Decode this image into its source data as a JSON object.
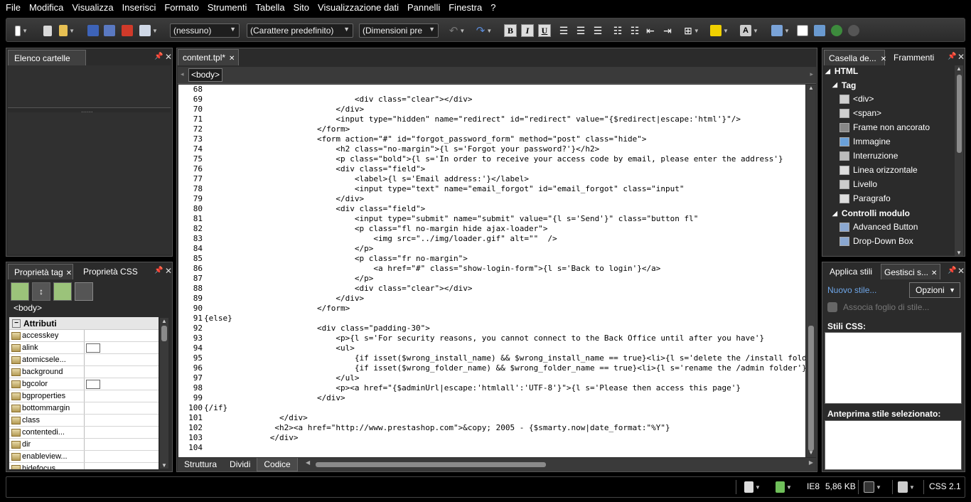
{
  "menu": [
    "File",
    "Modifica",
    "Visualizza",
    "Inserisci",
    "Formato",
    "Strumenti",
    "Tabella",
    "Sito",
    "Visualizzazione dati",
    "Pannelli",
    "Finestra",
    "?"
  ],
  "toolbar": {
    "style_select": "(nessuno)",
    "font_select": "(Carattere predefinito)",
    "size_select": "(Dimensioni pre",
    "bold": "B",
    "italic": "I",
    "underline": "U"
  },
  "folders_panel": {
    "title": "Elenco cartelle"
  },
  "tag_panel": {
    "tab1": "Proprietà tag",
    "tab2": "Proprietà CSS",
    "current_tag": "<body>",
    "section": "Attributi",
    "rows": [
      {
        "name": "accesskey",
        "has_color": false
      },
      {
        "name": "alink",
        "has_color": true
      },
      {
        "name": "atomicsele...",
        "has_color": false
      },
      {
        "name": "background",
        "has_color": false
      },
      {
        "name": "bgcolor",
        "has_color": true
      },
      {
        "name": "bgproperties",
        "has_color": false
      },
      {
        "name": "bottommargin",
        "has_color": false
      },
      {
        "name": "class",
        "has_color": false
      },
      {
        "name": "contentedi...",
        "has_color": false
      },
      {
        "name": "dir",
        "has_color": false
      },
      {
        "name": "enableview...",
        "has_color": false
      },
      {
        "name": "hidefocus",
        "has_color": false
      }
    ]
  },
  "editor": {
    "tab": "content.tpl*",
    "breadcrumb": "<body>",
    "lines": [
      {
        "n": "68",
        "t": ""
      },
      {
        "n": "69",
        "t": "                                &lt;div class=&quot;clear&quot;&gt;&lt;/div&gt;"
      },
      {
        "n": "70",
        "t": "                            &lt;/div&gt;"
      },
      {
        "n": "71",
        "t": "                            &lt;input type=&quot;hidden&quot; name=&quot;redirect&quot; id=&quot;redirect&quot; value=&quot;{$redirect|escape:'html'}&quot;/&gt;"
      },
      {
        "n": "72",
        "t": "                        &lt;/form&gt;"
      },
      {
        "n": "73",
        "t": "                        &lt;form action=&quot;#&quot; id=&quot;forgot_password_form&quot; method=&quot;post&quot; class=&quot;hide&quot;&gt;"
      },
      {
        "n": "74",
        "t": "                            &lt;h2 class=&quot;no-margin&quot;&gt;{l s='Forgot your password?'}&lt;/h2&gt;"
      },
      {
        "n": "75",
        "t": "                            &lt;p class=&quot;bold&quot;&gt;{l s='In order to receive your access code by email, please enter the address'}"
      },
      {
        "n": "76",
        "t": "                            &lt;div class=&quot;field&quot;&gt;"
      },
      {
        "n": "77",
        "t": "                                &lt;label&gt;{l s='Email address:'}&lt;/label&gt;"
      },
      {
        "n": "78",
        "t": "                                &lt;input type=&quot;text&quot; name=&quot;email_forgot&quot; id=&quot;email_forgot&quot; class=&quot;input&quot;"
      },
      {
        "n": "79",
        "t": "                            &lt;/div&gt;"
      },
      {
        "n": "80",
        "t": "                            &lt;div class=&quot;field&quot;&gt;"
      },
      {
        "n": "81",
        "t": "                                &lt;input type=&quot;submit&quot; name=&quot;submit&quot; value=&quot;{l s='Send'}&quot; class=&quot;button fl&quot;"
      },
      {
        "n": "82",
        "t": "                                &lt;p class=&quot;fl no-margin hide ajax-loader&quot;&gt;"
      },
      {
        "n": "83",
        "t": "                                    &lt;img src=&quot;../img/loader.gif&quot; alt=&quot;&quot;  /&gt;"
      },
      {
        "n": "84",
        "t": "                                &lt;/p&gt;"
      },
      {
        "n": "85",
        "t": "                                &lt;p class=&quot;fr no-margin&quot;&gt;"
      },
      {
        "n": "86",
        "t": "                                    &lt;a href=&quot;#&quot; class=&quot;show-login-form&quot;&gt;{l s='Back to login'}&lt;/a&gt;"
      },
      {
        "n": "87",
        "t": "                                &lt;/p&gt;"
      },
      {
        "n": "88",
        "t": "                                &lt;div class=&quot;clear&quot;&gt;&lt;/div&gt;"
      },
      {
        "n": "89",
        "t": "                            &lt;/div&gt;"
      },
      {
        "n": "90",
        "t": "                        &lt;/form&gt;"
      },
      {
        "n": "91",
        "t": "{else}"
      },
      {
        "n": "92",
        "t": "                        &lt;div class=&quot;padding-30&quot;&gt;"
      },
      {
        "n": "93",
        "t": "                            &lt;p&gt;{l s='For security reasons, you cannot connect to the Back Office until after you have'}"
      },
      {
        "n": "94",
        "t": "                            &lt;ul&gt;"
      },
      {
        "n": "95",
        "t": "                                {if isset($wrong_install_name) &amp;&amp; $wrong_install_name == true}&lt;li&gt;{l s='delete the /install folder'}"
      },
      {
        "n": "96",
        "t": "                                {if isset($wrong_folder_name) &amp;&amp; $wrong_folder_name == true}&lt;li&gt;{l s='rename the /admin folder'}"
      },
      {
        "n": "97",
        "t": "                            &lt;/ul&gt;"
      },
      {
        "n": "98",
        "t": "                            &lt;p&gt;&lt;a href=&quot;{$adminUrl|escape:'htmlall':'UTF-8'}&quot;&gt;{l s='Please then access this page'}"
      },
      {
        "n": "99",
        "t": "                        &lt;/div&gt;"
      },
      {
        "n": "100",
        "t": "{/if}"
      },
      {
        "n": "101",
        "t": "                &lt;/div&gt;"
      },
      {
        "n": "102",
        "t": "               &lt;h2&gt;&lt;a href=&quot;http://www.prestashop.com&quot;&gt;&amp;copy; 2005 - {$smarty.now|date_format:&quot;%Y&quot;}"
      },
      {
        "n": "103",
        "t": "              &lt;/div&gt;"
      },
      {
        "n": "104",
        "t": ""
      }
    ],
    "view_tabs": [
      "Struttura",
      "Dividi",
      "Codice"
    ],
    "active_view": "Codice"
  },
  "insert_panel": {
    "tab1": "Casella de...",
    "tab2": "Frammenti",
    "group_html": "HTML",
    "group_tag": "Tag",
    "tag_items": [
      "<div>",
      "<span>",
      "Frame non ancorato",
      "Immagine",
      "Interruzione",
      "Linea orizzontale",
      "Livello",
      "Paragrafo"
    ],
    "group_forms": "Controlli modulo",
    "form_items": [
      "Advanced Button",
      "Drop-Down Box"
    ]
  },
  "styles_panel": {
    "tab1": "Applica stili",
    "tab2": "Gestisci s...",
    "new_style": "Nuovo stile...",
    "options": "Opzioni",
    "attach": "Associa foglio di stile...",
    "css_styles": "Stili CSS:",
    "preview": "Anteprima stile selezionato:"
  },
  "statusbar": {
    "browser": "IE8",
    "size": "5,86 KB",
    "css": "CSS 2.1"
  }
}
